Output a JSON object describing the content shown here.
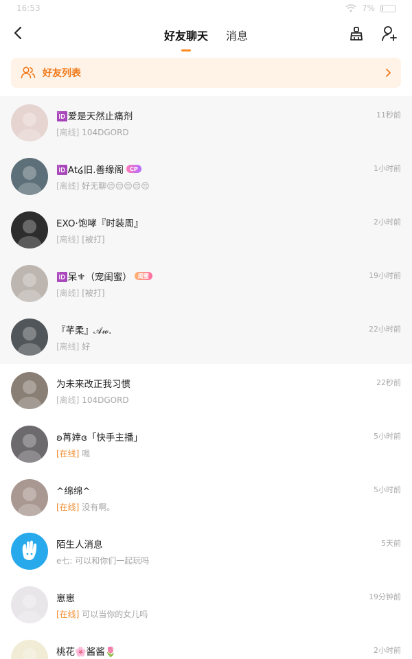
{
  "statusbar": {
    "time": "16:53",
    "battery": "7%"
  },
  "header": {
    "tabs": [
      {
        "label": "好友聊天",
        "active": true
      },
      {
        "label": "消息",
        "active": false
      }
    ]
  },
  "banner": {
    "label": "好友列表"
  },
  "chats": [
    {
      "name": "🆔爱是天然止痛剂",
      "status": "[离线]",
      "message": "104DGORD",
      "time": "11秒前",
      "badge": "",
      "pinned": true,
      "avatar_color": "#e6d4d0"
    },
    {
      "name": "🆔At໒旧.善缘阁",
      "status": "[离线]",
      "message": "好无聊😔😔😔😔😔",
      "time": "1小时前",
      "badge": "CP",
      "pinned": true,
      "avatar_color": "#5d6f78"
    },
    {
      "name": "EXO·饱哮『时装周』",
      "status": "[离线]",
      "message": "[被打]",
      "time": "2小时前",
      "badge": "",
      "pinned": true,
      "avatar_color": "#2d2d2d"
    },
    {
      "name": "🆔呆⚜（宠闺蜜）",
      "status": "[离线]",
      "message": "[被打]",
      "time": "19小时前",
      "badge": "闺蜜",
      "pinned": true,
      "avatar_color": "#bdb6b0"
    },
    {
      "name": "『芊柔』𝒜𝓌.",
      "status": "[离线]",
      "message": "好",
      "time": "22小时前",
      "badge": "",
      "pinned": true,
      "avatar_color": "#51565a"
    },
    {
      "name": "为未来改正我习惯",
      "status": "[离线]",
      "message": "104DGORD",
      "time": "22秒前",
      "badge": "",
      "pinned": false,
      "avatar_color": "#8a7f75"
    },
    {
      "name": "ʚ苒婞ɞ「快手主播」",
      "status": "[在线]",
      "message": "嗯",
      "time": "5小时前",
      "badge": "",
      "pinned": false,
      "avatar_color": "#6d6a6e"
    },
    {
      "name": "^绵绵^",
      "status": "[在线]",
      "message": "没有啊。",
      "time": "5小时前",
      "badge": "",
      "pinned": false,
      "avatar_color": "#a99891"
    },
    {
      "name": "陌生人消息",
      "status": "",
      "message": "e七: 可以和你们一起玩吗",
      "time": "5天前",
      "badge": "",
      "pinned": false,
      "avatar_color": "#27a9ec"
    },
    {
      "name": "崽崽",
      "status": "[在线]",
      "message": "可以当你的女儿吗",
      "time": "19分钟前",
      "badge": "",
      "pinned": false,
      "avatar_color": "#e9e6ea"
    },
    {
      "name": "桃花🌸酱酱🌷",
      "status": "",
      "message": "",
      "time": "2小时前",
      "badge": "",
      "pinned": false,
      "avatar_color": "#f1ecd6"
    }
  ],
  "colors": {
    "accent": "#ff8a1f",
    "banner_bg": "#fff3e8",
    "online": "#f28a2b"
  }
}
